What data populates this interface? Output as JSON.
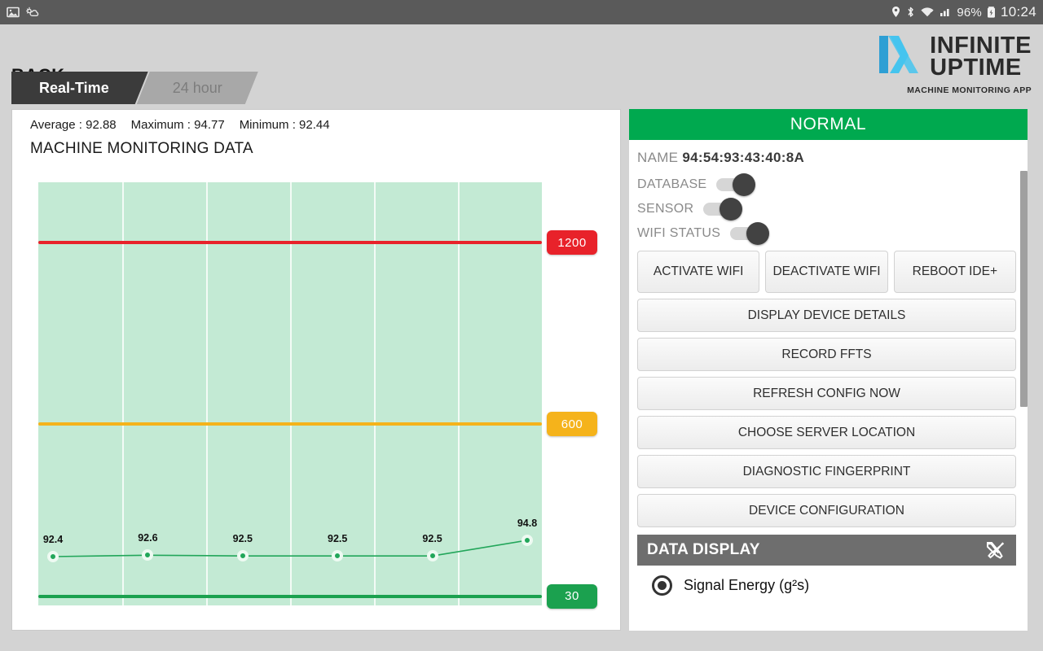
{
  "statusbar": {
    "left_icons": [
      "screenshot-icon",
      "weather-icon"
    ],
    "right_icons": [
      "location-icon",
      "bluetooth-icon",
      "wifi-icon",
      "signal-icon",
      "battery-charging-icon"
    ],
    "battery": "96%",
    "clock": "10:24"
  },
  "header": {
    "back_label": "BACK",
    "logo": {
      "word1": "INFINITE",
      "word2": "UPTIME",
      "tagline": "MACHINE MONITORING APP",
      "mark_color": "#29b6e8"
    }
  },
  "tabs": [
    {
      "label": "Real-Time",
      "active": true
    },
    {
      "label": "24 hour",
      "active": false
    }
  ],
  "chart_panel": {
    "stats": [
      "Average : 92.88",
      "Maximum : 94.77",
      "Minimum : 92.44"
    ],
    "title": "MACHINE MONITORING DATA"
  },
  "chart_data": {
    "type": "line",
    "title": "MACHINE MONITORING DATA",
    "xlabel": "",
    "ylabel": "",
    "grid": true,
    "legend": "none",
    "ylim": [
      0,
      1400
    ],
    "x": [
      0,
      1,
      2,
      3,
      4,
      5
    ],
    "values": [
      92.4,
      92.6,
      92.5,
      92.5,
      92.5,
      94.8
    ],
    "point_labels": [
      "92.4",
      "92.6",
      "92.5",
      "92.5",
      "92.5",
      "94.8"
    ],
    "series": [
      {
        "name": "Signal Energy (g²s)",
        "values": [
          92.4,
          92.6,
          92.5,
          92.5,
          92.5,
          94.8
        ],
        "color": "#22a65a"
      }
    ],
    "thresholds": [
      {
        "label": "1200",
        "value": 1200,
        "color": "#e8222a",
        "badge_text_color": "#ffffff"
      },
      {
        "label": "600",
        "value": 600,
        "color": "#f5b31b",
        "badge_text_color": "#ffffff"
      },
      {
        "label": "30",
        "value": 30,
        "color": "#1ba14f",
        "badge_text_color": "#ffffff"
      }
    ],
    "plot_bg": "#c3ead4",
    "summary": {
      "average": 92.88,
      "maximum": 94.77,
      "minimum": 92.44
    }
  },
  "device_panel": {
    "status": "NORMAL",
    "status_color": "#00a94f",
    "name_label": "NAME",
    "name_value": "94:54:93:43:40:8A",
    "toggles": [
      {
        "label": "DATABASE",
        "on": true
      },
      {
        "label": "SENSOR",
        "on": true
      },
      {
        "label": "WIFI STATUS",
        "on": true
      }
    ],
    "action_row": [
      "ACTIVATE WIFI",
      "DEACTIVATE WIFI",
      "REBOOT IDE+"
    ],
    "actions": [
      "DISPLAY DEVICE DETAILS",
      "RECORD FFTS",
      "REFRESH CONFIG NOW",
      "CHOOSE SERVER LOCATION",
      "DIAGNOSTIC FINGERPRINT",
      "DEVICE CONFIGURATION"
    ],
    "data_display": {
      "title": "DATA DISPLAY",
      "tools_icon": "tools-icon",
      "options": [
        {
          "label": "Signal Energy (g²s)",
          "selected": true
        }
      ]
    }
  }
}
